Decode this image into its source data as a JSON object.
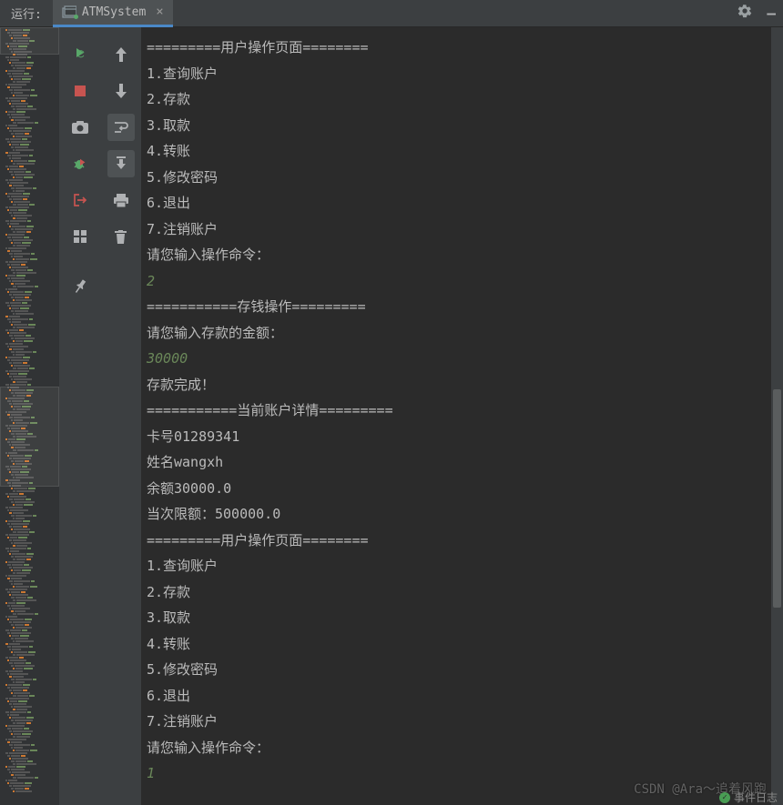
{
  "header": {
    "run_label": "运行:",
    "tab_name": "ATMSystem"
  },
  "console_lines": [
    {
      "text": "=========用户操作页面========",
      "type": "out"
    },
    {
      "text": "1.查询账户",
      "type": "out"
    },
    {
      "text": "2.存款",
      "type": "out"
    },
    {
      "text": "3.取款",
      "type": "out"
    },
    {
      "text": "4.转账",
      "type": "out"
    },
    {
      "text": "5.修改密码",
      "type": "out"
    },
    {
      "text": "6.退出",
      "type": "out"
    },
    {
      "text": "7.注销账户",
      "type": "out"
    },
    {
      "text": "请您输入操作命令：",
      "type": "out"
    },
    {
      "text": "2",
      "type": "in"
    },
    {
      "text": "===========存钱操作=========",
      "type": "out"
    },
    {
      "text": "请您输入存款的金额：",
      "type": "out"
    },
    {
      "text": "30000",
      "type": "in"
    },
    {
      "text": "存款完成！",
      "type": "out"
    },
    {
      "text": "===========当前账户详情=========",
      "type": "out"
    },
    {
      "text": "卡号01289341",
      "type": "out"
    },
    {
      "text": "姓名wangxh",
      "type": "out"
    },
    {
      "text": "余额30000.0",
      "type": "out"
    },
    {
      "text": "当次限额：500000.0",
      "type": "out"
    },
    {
      "text": "=========用户操作页面========",
      "type": "out"
    },
    {
      "text": "1.查询账户",
      "type": "out"
    },
    {
      "text": "2.存款",
      "type": "out"
    },
    {
      "text": "3.取款",
      "type": "out"
    },
    {
      "text": "4.转账",
      "type": "out"
    },
    {
      "text": "5.修改密码",
      "type": "out"
    },
    {
      "text": "6.退出",
      "type": "out"
    },
    {
      "text": "7.注销账户",
      "type": "out"
    },
    {
      "text": "请您输入操作命令：",
      "type": "out"
    },
    {
      "text": "1",
      "type": "in"
    }
  ],
  "watermark": "CSDN @Ara～追着风跑",
  "status_text": "事件日志"
}
